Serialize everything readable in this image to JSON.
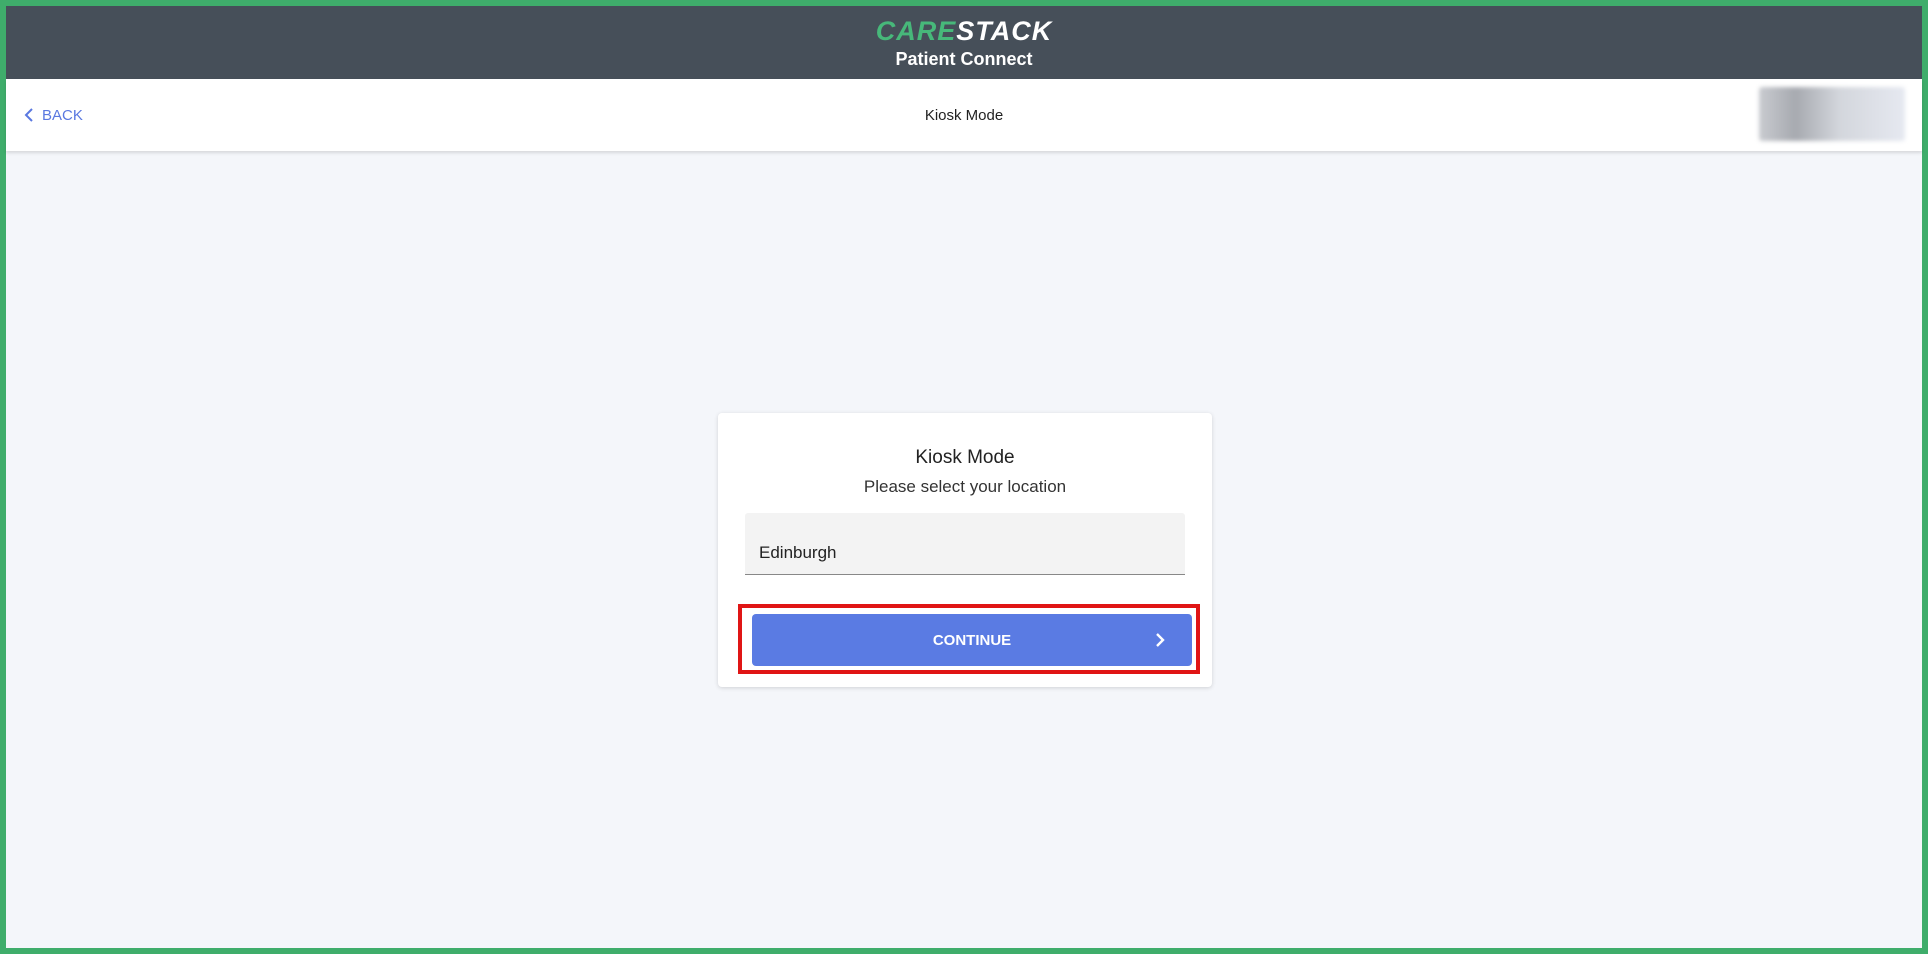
{
  "brand": {
    "logo_part1": "CARE",
    "logo_part2": "STACK",
    "subtitle": "Patient Connect",
    "accent": "#47b87a",
    "bar_color": "#464f59"
  },
  "nav": {
    "back_label": "BACK",
    "title": "Kiosk Mode",
    "back_icon": "chevron-left-icon"
  },
  "card": {
    "title": "Kiosk Mode",
    "subtitle": "Please select your location",
    "location_value": "Edinburgh",
    "continue_label": "CONTINUE",
    "continue_icon": "chevron-right-icon",
    "button_color": "#5a7be3",
    "highlight_color": "#e01515"
  },
  "frame_color": "#3fad6b"
}
